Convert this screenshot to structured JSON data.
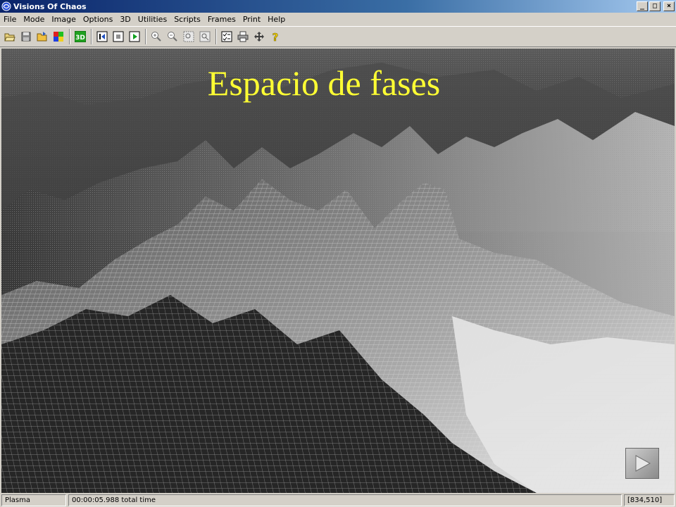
{
  "window": {
    "title": "Visions Of Chaos"
  },
  "menu": [
    "File",
    "Mode",
    "Image",
    "Options",
    "3D",
    "Utilities",
    "Scripts",
    "Frames",
    "Print",
    "Help"
  ],
  "toolbar": {
    "buttons": [
      "open-icon",
      "save-icon",
      "folder-open-icon",
      "palette-icon",
      "3d-icon",
      "rewind-icon",
      "stop-icon",
      "play-icon",
      "zoom-in-icon",
      "zoom-out-icon",
      "zoom-region-icon",
      "zoom-fit-icon",
      "checklist-icon",
      "print-icon",
      "move-icon",
      "help-icon"
    ],
    "label_3d": "3D"
  },
  "canvas": {
    "overlay_title": "Espacio de fases"
  },
  "status": {
    "mode": "Plasma",
    "time": "00:00:05.988 total time",
    "coords": "[834,510]"
  },
  "colors": {
    "title_gradient_start": "#0a246a",
    "overlay_title": "#ffff33",
    "chrome": "#d4d0c8"
  }
}
